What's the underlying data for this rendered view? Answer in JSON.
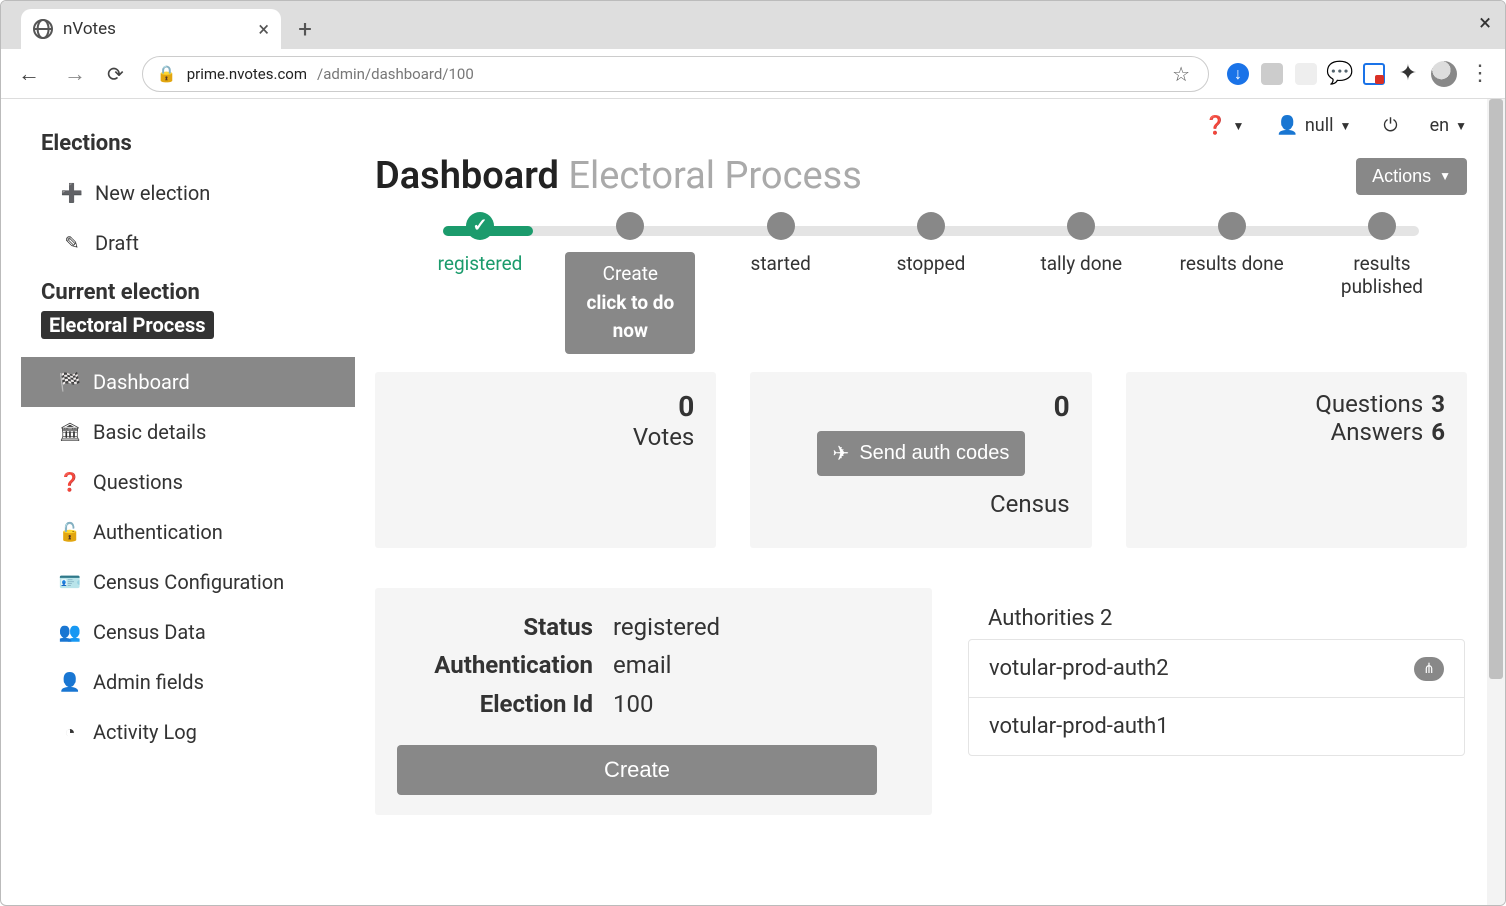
{
  "browser": {
    "tab_title": "nVotes",
    "url_host": "prime.nvotes.com",
    "url_path": "/admin/dashboard/100"
  },
  "topbar": {
    "user_label": "null",
    "lang_label": "en"
  },
  "sidebar": {
    "title": "Elections",
    "new_election": "New election",
    "draft": "Draft",
    "current_label": "Current election",
    "current_name": "Electoral Process",
    "nav": {
      "dashboard": "Dashboard",
      "basic": "Basic details",
      "questions": "Questions",
      "auth": "Authentication",
      "census_cfg": "Census Configuration",
      "census_data": "Census Data",
      "admin_fields": "Admin fields",
      "activity": "Activity Log"
    }
  },
  "heading": {
    "main": "Dashboard",
    "sub": "Electoral Process",
    "actions_label": "Actions"
  },
  "steps": {
    "s1": "registered",
    "s2_popup_l1": "Create",
    "s2_popup_l2": "click to do now",
    "s3": "started",
    "s4": "stopped",
    "s5": "tally done",
    "s6": "results done",
    "s7": "results published"
  },
  "cards": {
    "votes_count": "0",
    "votes_label": "Votes",
    "census_count": "0",
    "census_label": "Census",
    "send_auth": "Send auth codes",
    "questions_label": "Questions",
    "questions_count": "3",
    "answers_label": "Answers",
    "answers_count": "6"
  },
  "info": {
    "status_k": "Status",
    "status_v": "registered",
    "auth_k": "Authentication",
    "auth_v": "email",
    "id_k": "Election Id",
    "id_v": "100"
  },
  "authorities": {
    "title": "Authorities 2",
    "a1": "votular-prod-auth2",
    "a2": "votular-prod-auth1"
  },
  "create_btn": "Create"
}
